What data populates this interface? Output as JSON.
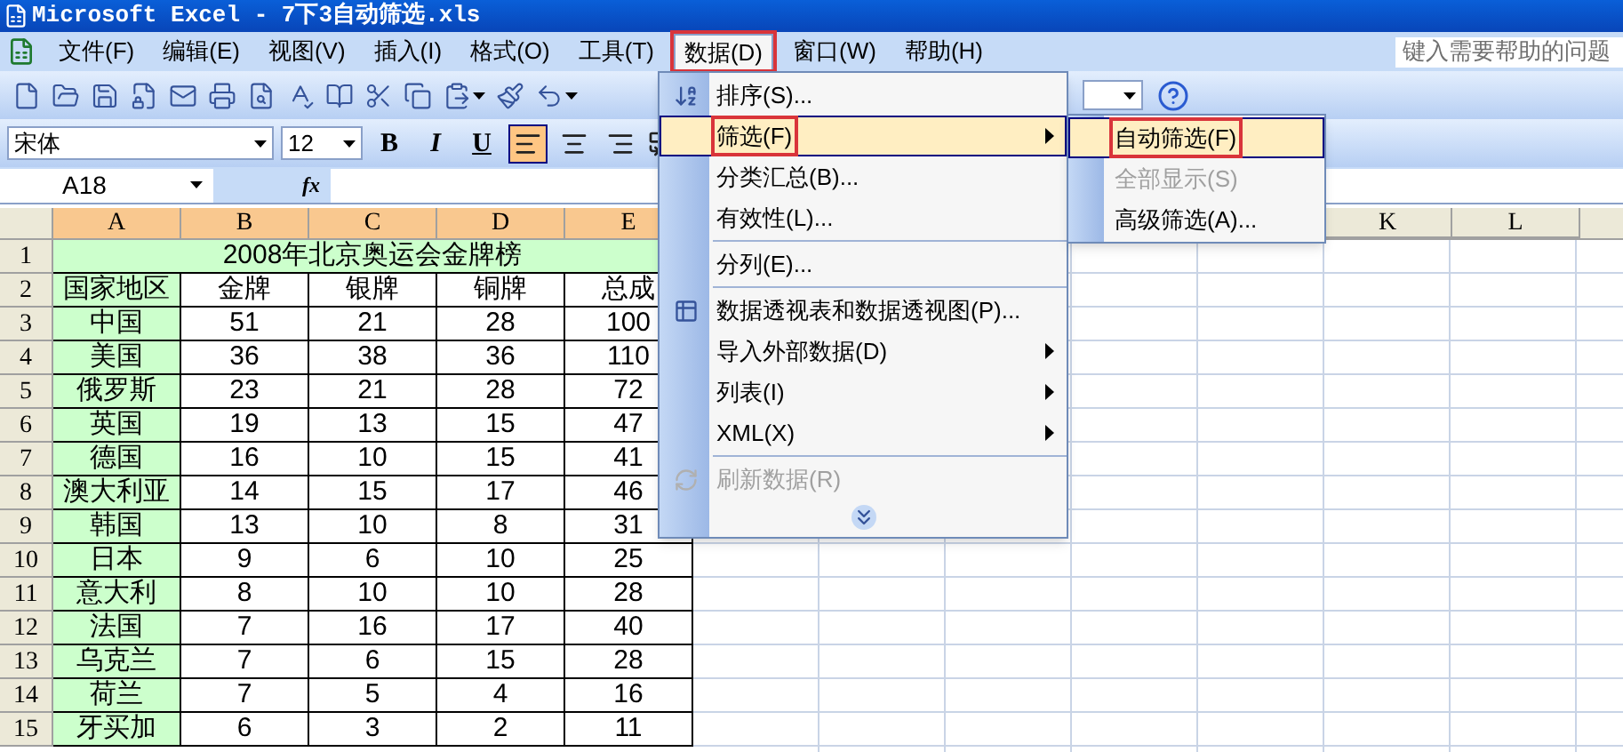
{
  "window": {
    "title": "Microsoft Excel - 7下3自动筛选.xls"
  },
  "menubar": [
    {
      "label": "文件(F)",
      "selected": false
    },
    {
      "label": "编辑(E)",
      "selected": false
    },
    {
      "label": "视图(V)",
      "selected": false
    },
    {
      "label": "插入(I)",
      "selected": false
    },
    {
      "label": "格式(O)",
      "selected": false
    },
    {
      "label": "工具(T)",
      "selected": false
    },
    {
      "label": "数据(D)",
      "selected": true,
      "outlined": true
    },
    {
      "label": "窗口(W)",
      "selected": false
    },
    {
      "label": "帮助(H)",
      "selected": false
    }
  ],
  "help_box": {
    "placeholder": "键入需要帮助的问题"
  },
  "formatting": {
    "font": "宋体",
    "size": "12",
    "styles": [
      "B",
      "I",
      "U"
    ],
    "align": [
      {
        "selected": true
      },
      {
        "selected": false
      },
      {
        "selected": false
      }
    ]
  },
  "formula_bar": {
    "name_box": "A18",
    "function_label": "fx"
  },
  "data_menu": {
    "items": [
      {
        "kind": "item",
        "label": "排序(S)...",
        "selected": false,
        "disabled": false,
        "submenu": false
      },
      {
        "kind": "item",
        "label": "筛选(F)",
        "selected": true,
        "disabled": false,
        "submenu": true,
        "outlined": true
      },
      {
        "kind": "item",
        "label": "分类汇总(B)...",
        "selected": false,
        "disabled": false,
        "submenu": false
      },
      {
        "kind": "item",
        "label": "有效性(L)...",
        "selected": false,
        "disabled": false,
        "submenu": false
      },
      {
        "kind": "separator"
      },
      {
        "kind": "item",
        "label": "分列(E)...",
        "selected": false,
        "disabled": false,
        "submenu": false
      },
      {
        "kind": "separator"
      },
      {
        "kind": "item",
        "label": "数据透视表和数据透视图(P)...",
        "selected": false,
        "disabled": false,
        "submenu": false
      },
      {
        "kind": "item",
        "label": "导入外部数据(D)",
        "selected": false,
        "disabled": false,
        "submenu": true
      },
      {
        "kind": "item",
        "label": "列表(I)",
        "selected": false,
        "disabled": false,
        "submenu": true
      },
      {
        "kind": "item",
        "label": "XML(X)",
        "selected": false,
        "disabled": false,
        "submenu": true
      },
      {
        "kind": "separator"
      },
      {
        "kind": "item",
        "label": "刷新数据(R)",
        "selected": false,
        "disabled": true,
        "submenu": false
      },
      {
        "kind": "expand"
      }
    ]
  },
  "filter_submenu": {
    "items": [
      {
        "label": "自动筛选(F)",
        "selected": true,
        "disabled": false,
        "outlined": true
      },
      {
        "label": "全部显示(S)",
        "selected": false,
        "disabled": true
      },
      {
        "label": "高级筛选(A)...",
        "selected": false,
        "disabled": false
      }
    ]
  },
  "sheet": {
    "columns": [
      {
        "label": "A",
        "selected": true
      },
      {
        "label": "B",
        "selected": true
      },
      {
        "label": "C",
        "selected": true
      },
      {
        "label": "D",
        "selected": true
      },
      {
        "label": "E",
        "selected": true
      },
      {
        "label": "K",
        "selected": false
      },
      {
        "label": "L",
        "selected": false
      }
    ],
    "title_row": {
      "number": "1",
      "text": "2008年北京奥运会金牌榜"
    },
    "rows": [
      {
        "number": "2",
        "cells": [
          "国家地区",
          "金牌",
          "银牌",
          "铜牌",
          "总成"
        ]
      },
      {
        "number": "3",
        "cells": [
          "中国",
          "51",
          "21",
          "28",
          "100"
        ]
      },
      {
        "number": "4",
        "cells": [
          "美国",
          "36",
          "38",
          "36",
          "110"
        ]
      },
      {
        "number": "5",
        "cells": [
          "俄罗斯",
          "23",
          "21",
          "28",
          "72"
        ]
      },
      {
        "number": "6",
        "cells": [
          "英国",
          "19",
          "13",
          "15",
          "47"
        ]
      },
      {
        "number": "7",
        "cells": [
          "德国",
          "16",
          "10",
          "15",
          "41"
        ]
      },
      {
        "number": "8",
        "cells": [
          "澳大利亚",
          "14",
          "15",
          "17",
          "46"
        ]
      },
      {
        "number": "9",
        "cells": [
          "韩国",
          "13",
          "10",
          "8",
          "31"
        ]
      },
      {
        "number": "10",
        "cells": [
          "日本",
          "9",
          "6",
          "10",
          "25"
        ]
      },
      {
        "number": "11",
        "cells": [
          "意大利",
          "8",
          "10",
          "10",
          "28"
        ]
      },
      {
        "number": "12",
        "cells": [
          "法国",
          "7",
          "16",
          "17",
          "40"
        ]
      },
      {
        "number": "13",
        "cells": [
          "乌克兰",
          "7",
          "6",
          "15",
          "28"
        ]
      },
      {
        "number": "14",
        "cells": [
          "荷兰",
          "7",
          "5",
          "4",
          "16"
        ]
      },
      {
        "number": "15",
        "cells": [
          "牙买加",
          "6",
          "3",
          "2",
          "11"
        ]
      }
    ]
  }
}
